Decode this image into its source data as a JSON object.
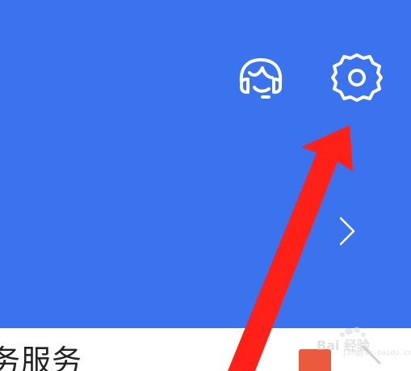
{
  "header": {
    "background": "#3b73ef",
    "icons": {
      "service": "headset-icon",
      "settings": "gear-icon",
      "chevron": "chevron-right-icon"
    }
  },
  "card": {
    "title": "务服务",
    "badge_color": "#ea5a3c"
  },
  "watermark": {
    "text": "Bai 经验",
    "subtext": "jingyan.baidu.com"
  },
  "annotation": {
    "arrow_color": "#ff2018"
  }
}
